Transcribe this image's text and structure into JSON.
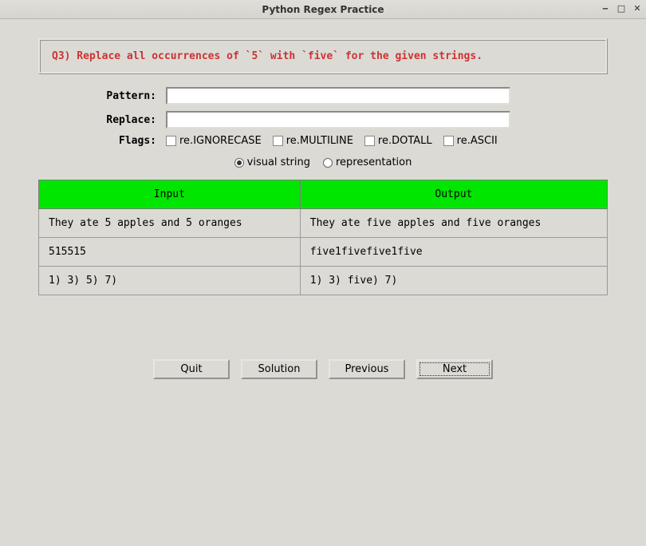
{
  "window": {
    "title": "Python Regex Practice"
  },
  "question": {
    "text": "Q3) Replace all occurrences of `5` with `five` for the given strings."
  },
  "form": {
    "pattern_label": "Pattern:",
    "pattern_value": "",
    "replace_label": "Replace:",
    "replace_value": "",
    "flags_label": "Flags:"
  },
  "flags": [
    {
      "label": "re.IGNORECASE",
      "checked": false
    },
    {
      "label": "re.MULTILINE",
      "checked": false
    },
    {
      "label": "re.DOTALL",
      "checked": false
    },
    {
      "label": "re.ASCII",
      "checked": false
    }
  ],
  "radios": {
    "visual": "visual string",
    "representation": "representation",
    "selected": "visual"
  },
  "table": {
    "headers": {
      "input": "Input",
      "output": "Output"
    },
    "rows": [
      {
        "input": "They ate 5 apples and 5 oranges",
        "output": "They ate five apples and five oranges"
      },
      {
        "input": "515515",
        "output": "five1fivefive1five"
      },
      {
        "input": "1) 3) 5) 7)",
        "output": "1) 3) five) 7)"
      }
    ]
  },
  "buttons": {
    "quit": "Quit",
    "solution": "Solution",
    "previous": "Previous",
    "next": "Next"
  }
}
